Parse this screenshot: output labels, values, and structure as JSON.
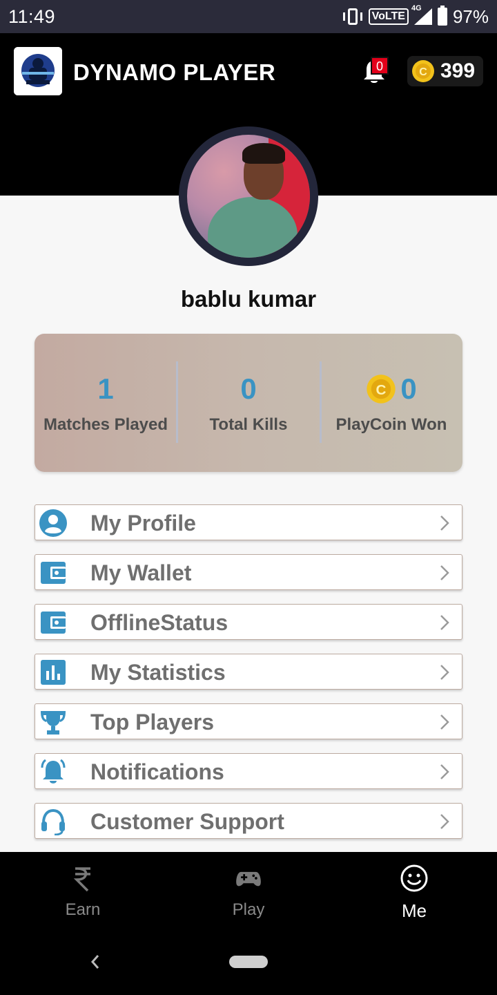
{
  "status_bar": {
    "time": "11:49",
    "network": "VoLTE",
    "network_gen": "4G",
    "battery": "97%"
  },
  "header": {
    "title": "DYNAMO PLAYER",
    "notification_count": "0",
    "coins": "399"
  },
  "profile": {
    "name": "bablu kumar"
  },
  "stats": [
    {
      "value": "1",
      "label": "Matches Played"
    },
    {
      "value": "0",
      "label": "Total Kills"
    },
    {
      "value": "0",
      "label": "PlayCoin Won"
    }
  ],
  "menu": [
    {
      "label": "My Profile",
      "icon": "person-icon"
    },
    {
      "label": "My Wallet",
      "icon": "wallet-icon"
    },
    {
      "label": "OfflineStatus",
      "icon": "wallet-icon"
    },
    {
      "label": "My Statistics",
      "icon": "bar-chart-icon"
    },
    {
      "label": "Top Players",
      "icon": "trophy-icon"
    },
    {
      "label": "Notifications",
      "icon": "bell-icon"
    },
    {
      "label": "Customer Support",
      "icon": "headset-icon"
    }
  ],
  "bottom_nav": [
    {
      "label": "Earn",
      "icon": "rupee-icon",
      "active": false
    },
    {
      "label": "Play",
      "icon": "gamepad-icon",
      "active": false
    },
    {
      "label": "Me",
      "icon": "smiley-icon",
      "active": true
    }
  ],
  "colors": {
    "accent": "#3a93c3",
    "menu_text": "#6f6f6f",
    "badge": "#e2001a"
  }
}
